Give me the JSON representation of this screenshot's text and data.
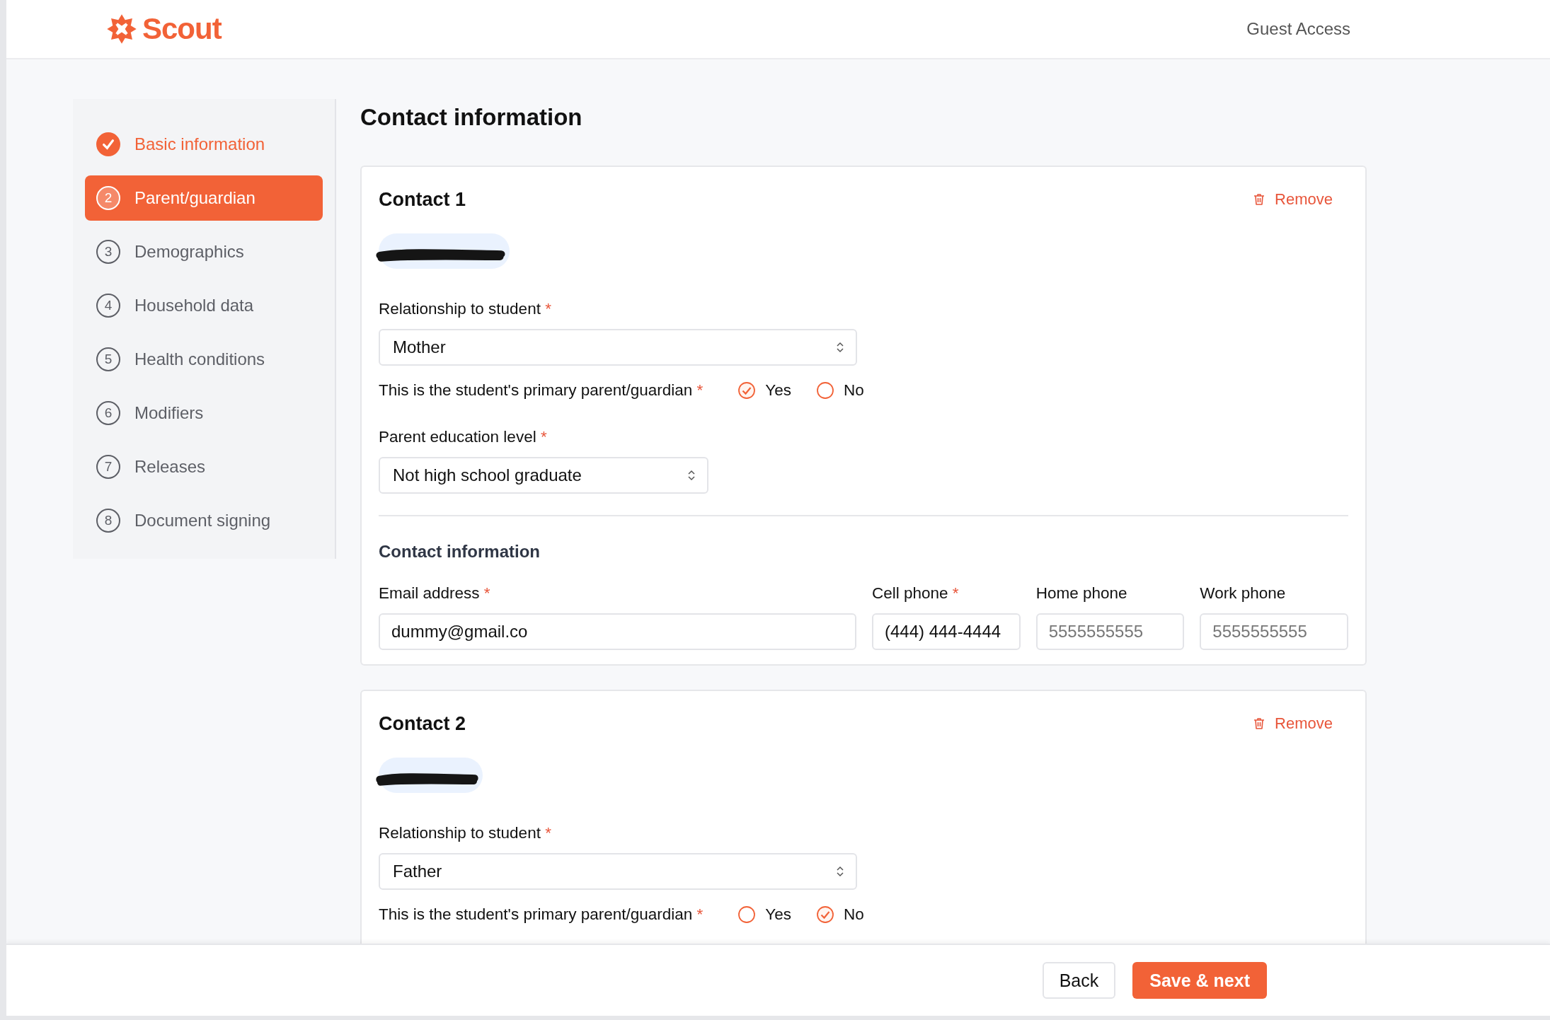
{
  "header": {
    "logo": "Scout",
    "guest": "Guest Access"
  },
  "required_mark": "*",
  "steps": [
    {
      "kind": "done",
      "label": "Basic information",
      "selected": false
    },
    {
      "kind": "current",
      "number": "2",
      "label": "Parent/guardian",
      "selected": true
    },
    {
      "kind": "todo",
      "number": "3",
      "label": "Demographics",
      "selected": false
    },
    {
      "kind": "todo",
      "number": "4",
      "label": "Household data",
      "selected": false
    },
    {
      "kind": "todo",
      "number": "5",
      "label": "Health conditions",
      "selected": false
    },
    {
      "kind": "todo",
      "number": "6",
      "label": "Modifiers",
      "selected": false
    },
    {
      "kind": "todo",
      "number": "7",
      "label": "Releases",
      "selected": false
    },
    {
      "kind": "todo",
      "number": "8",
      "label": "Document signing",
      "selected": false
    }
  ],
  "title": "Contact information",
  "contacts": [
    {
      "title": "Contact 1",
      "remove": "Remove",
      "name_redacted": true,
      "relationship_label": "Relationship to student",
      "relationship": "Mother",
      "primary_label": "This is the student's primary parent/guardian",
      "options": [
        {
          "label": "Yes",
          "selected": true
        },
        {
          "label": "No",
          "selected": false
        }
      ],
      "education_label": "Parent education level",
      "education": "Not high school graduate",
      "section": "Contact information",
      "fields": [
        {
          "label": "Email address",
          "required": true,
          "value": "dummy@gmail.co"
        },
        {
          "label": "Cell phone",
          "required": true,
          "value": "(444) 444-4444"
        },
        {
          "label": "Home phone",
          "required": false,
          "placeholder": "5555555555"
        },
        {
          "label": "Work phone",
          "required": false,
          "placeholder": "5555555555"
        }
      ]
    },
    {
      "title": "Contact 2",
      "remove": "Remove",
      "name_redacted": true,
      "relationship_label": "Relationship to student",
      "relationship": "Father",
      "primary_label": "This is the student's primary parent/guardian",
      "options": [
        {
          "label": "Yes",
          "selected": false
        },
        {
          "label": "No",
          "selected": true
        }
      ]
    }
  ],
  "buttons": {
    "back": "Back",
    "next": "Save & next"
  }
}
